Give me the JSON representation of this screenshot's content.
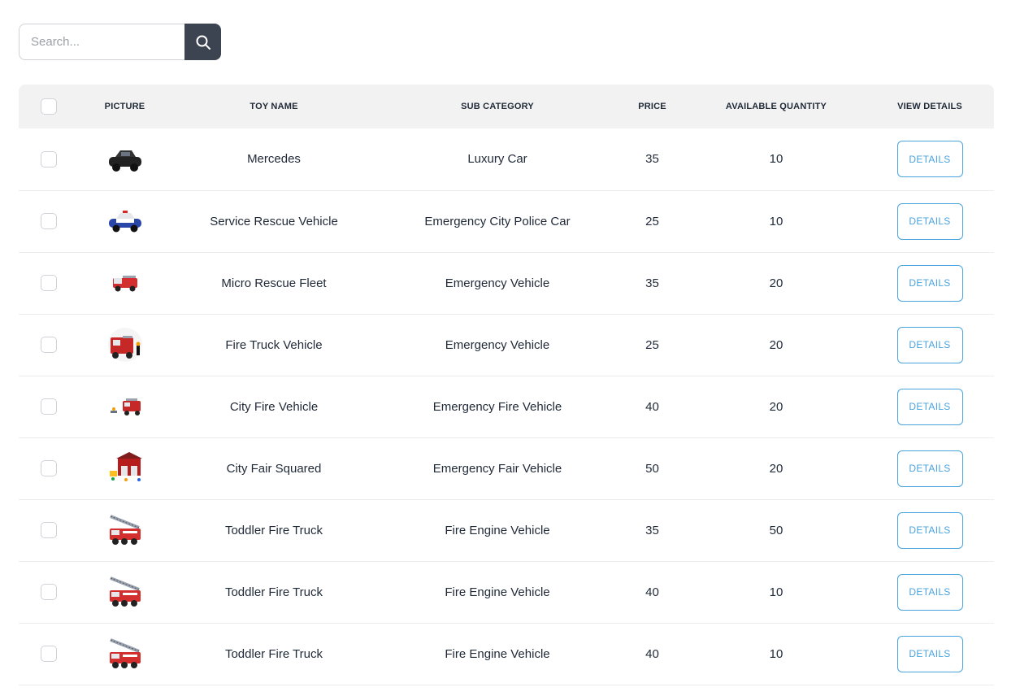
{
  "search": {
    "placeholder": "Search..."
  },
  "table": {
    "headers": [
      "PICTURE",
      "TOY NAME",
      "SUB CATEGORY",
      "PRICE",
      "AVAILABLE QUANTITY",
      "VIEW DETAILS"
    ],
    "rows": [
      {
        "picture": "black-toy-car-icon",
        "name": "Mercedes",
        "sub_category": "Luxury Car",
        "price": "35",
        "quantity": "10",
        "button": "DETAILS"
      },
      {
        "picture": "police-car-icon",
        "name": "Service Rescue Vehicle",
        "sub_category": "Emergency City Police Car",
        "price": "25",
        "quantity": "10",
        "button": "DETAILS"
      },
      {
        "picture": "small-fire-truck-icon",
        "name": "Micro Rescue Fleet",
        "sub_category": "Emergency Vehicle",
        "price": "35",
        "quantity": "20",
        "button": "DETAILS"
      },
      {
        "picture": "fire-truck-set-icon",
        "name": "Fire Truck Vehicle",
        "sub_category": "Emergency Vehicle",
        "price": "25",
        "quantity": "20",
        "button": "DETAILS"
      },
      {
        "picture": "fire-vehicle-set-icon",
        "name": "City Fire Vehicle",
        "sub_category": "Emergency Fire Vehicle",
        "price": "40",
        "quantity": "20",
        "button": "DETAILS"
      },
      {
        "picture": "fire-station-set-icon",
        "name": "City Fair Squared",
        "sub_category": "Emergency Fair Vehicle",
        "price": "50",
        "quantity": "20",
        "button": "DETAILS"
      },
      {
        "picture": "ladder-fire-truck-icon",
        "name": "Toddler Fire Truck",
        "sub_category": "Fire Engine Vehicle",
        "price": "35",
        "quantity": "50",
        "button": "DETAILS"
      },
      {
        "picture": "ladder-fire-truck-icon",
        "name": "Toddler Fire Truck",
        "sub_category": "Fire Engine Vehicle",
        "price": "40",
        "quantity": "10",
        "button": "DETAILS"
      },
      {
        "picture": "ladder-fire-truck-icon",
        "name": "Toddler Fire Truck",
        "sub_category": "Fire Engine Vehicle",
        "price": "40",
        "quantity": "10",
        "button": "DETAILS"
      }
    ]
  },
  "colors": {
    "search_button": "#3d4451",
    "details_accent": "#4aa3df",
    "header_bg": "#f2f2f2"
  }
}
